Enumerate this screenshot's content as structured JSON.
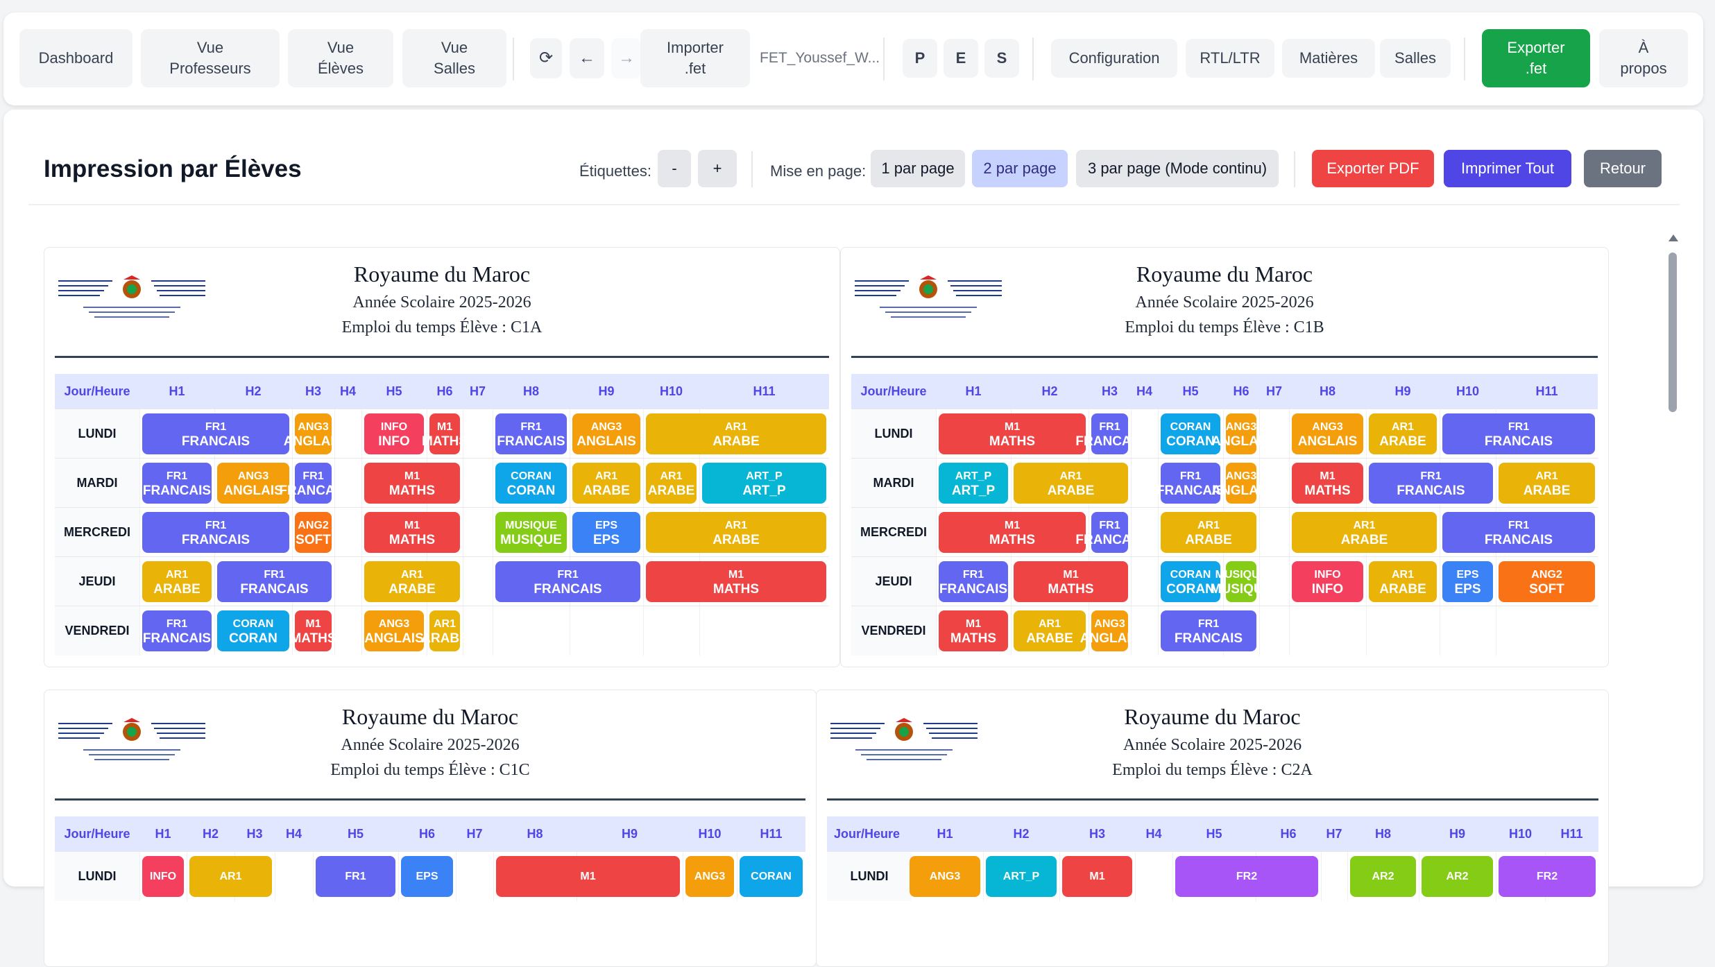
{
  "toolbar": {
    "dashboard": "Dashboard",
    "teachers_l1": "Vue",
    "teachers_l2": "Professeurs",
    "students_l1": "Vue",
    "students_l2": "Élèves",
    "rooms_l1": "Vue",
    "rooms_l2": "Salles",
    "refresh": "⟳",
    "back": "←",
    "forward": "→",
    "import_l1": "Importer",
    "import_l2": ".fet",
    "file_name": "FET_Youssef_W...",
    "p": "P",
    "e": "E",
    "s": "S",
    "configuration": "Configuration",
    "rtl": "RTL/LTR",
    "subjects": "Matières",
    "rooms": "Salles",
    "export_l1": "Exporter",
    "export_l2": ".fet",
    "about_l1": "À",
    "about_l2": "propos"
  },
  "panel": {
    "title": "Impression par Élèves",
    "labels_label": "Étiquettes:",
    "minus": "-",
    "plus": "+",
    "layout_label": "Mise en page:",
    "one_per_page": "1 par page",
    "two_per_page": "2 par page",
    "three_per_page": "3 par page (Mode continu)",
    "export_pdf": "Exporter PDF",
    "print_all": "Imprimer Tout",
    "back": "Retour"
  },
  "colors": {
    "FR": "#6366f1",
    "ANG": "#f59e0b",
    "INFO": "#f43f5e",
    "M": "#ef4444",
    "AR": "#eab308",
    "CORAN": "#0ea5e9",
    "ART": "#06b6d4",
    "MUSIQUE": "#84cc16",
    "EPS": "#3b82f6",
    "SOFT": "#f97316",
    "FR2": "#a855f7",
    "AR2": "#84cc16"
  },
  "common": {
    "kingdom": "Royaume du Maroc",
    "year": "Année Scolaire 2025-2026",
    "col_header": "Jour/Heure",
    "hours": [
      "H1",
      "H2",
      "H3",
      "H4",
      "H5",
      "H6",
      "H7",
      "H8",
      "H9",
      "H10",
      "H11"
    ],
    "days": [
      "LUNDI",
      "MARDI",
      "MERCREDI",
      "JEUDI",
      "VENDREDI"
    ]
  },
  "cards": [
    {
      "title": "Emploi du temps Élève : C1A",
      "rows": [
        [
          [
            "FR1",
            "FRANCAIS",
            "FR",
            1,
            2
          ],
          [
            "ANG3",
            "ANGLAIS",
            "ANG",
            3,
            1
          ],
          [
            "INFO",
            "INFO",
            "INFO",
            5,
            1
          ],
          [
            "M1",
            "MATHS",
            "M",
            6,
            1
          ],
          [
            "FR1",
            "FRANCAIS",
            "FR",
            8,
            1
          ],
          [
            "ANG3",
            "ANGLAIS",
            "ANG",
            9,
            1
          ],
          [
            "AR1",
            "ARABE",
            "AR",
            10,
            2
          ]
        ],
        [
          [
            "FR1",
            "FRANCAIS",
            "FR",
            1,
            1
          ],
          [
            "ANG3",
            "ANGLAIS",
            "ANG",
            2,
            1
          ],
          [
            "FR1",
            "FRANCAIS",
            "FR",
            3,
            1
          ],
          [
            "M1",
            "MATHS",
            "M",
            5,
            2
          ],
          [
            "CORAN",
            "CORAN",
            "CORAN",
            8,
            1
          ],
          [
            "AR1",
            "ARABE",
            "AR",
            9,
            1
          ],
          [
            "AR1",
            "ARABE",
            "AR",
            10,
            1
          ],
          [
            "ART_P",
            "ART_P",
            "ART",
            11,
            1
          ]
        ],
        [
          [
            "FR1",
            "FRANCAIS",
            "FR",
            1,
            2
          ],
          [
            "ANG2",
            "SOFT",
            "SOFT",
            3,
            1
          ],
          [
            "M1",
            "MATHS",
            "M",
            5,
            2
          ],
          [
            "MUSIQUE",
            "MUSIQUE",
            "MUSIQUE",
            8,
            1
          ],
          [
            "EPS",
            "EPS",
            "EPS",
            9,
            1
          ],
          [
            "AR1",
            "ARABE",
            "AR",
            10,
            2
          ]
        ],
        [
          [
            "AR1",
            "ARABE",
            "AR",
            1,
            1
          ],
          [
            "FR1",
            "FRANCAIS",
            "FR",
            2,
            2
          ],
          [
            "AR1",
            "ARABE",
            "AR",
            5,
            2
          ],
          [
            "FR1",
            "FRANCAIS",
            "FR",
            8,
            2
          ],
          [
            "M1",
            "MATHS",
            "M",
            10,
            2
          ]
        ],
        [
          [
            "FR1",
            "FRANCAIS",
            "FR",
            1,
            1
          ],
          [
            "CORAN",
            "CORAN",
            "CORAN",
            2,
            1
          ],
          [
            "M1",
            "MATHS",
            "M",
            3,
            1
          ],
          [
            "ANG3",
            "ANGLAIS",
            "ANG",
            5,
            1
          ],
          [
            "AR1",
            "ARABE",
            "AR",
            6,
            1
          ]
        ]
      ]
    },
    {
      "title": "Emploi du temps Élève : C1B",
      "rows": [
        [
          [
            "M1",
            "MATHS",
            "M",
            1,
            2
          ],
          [
            "FR1",
            "FRANCAIS",
            "FR",
            3,
            1
          ],
          [
            "CORAN",
            "CORAN",
            "CORAN",
            5,
            1
          ],
          [
            "ANG3",
            "ANGLAIS",
            "ANG",
            6,
            1
          ],
          [
            "ANG3",
            "ANGLAIS",
            "ANG",
            8,
            1
          ],
          [
            "AR1",
            "ARABE",
            "AR",
            9,
            1
          ],
          [
            "FR1",
            "FRANCAIS",
            "FR",
            10,
            2
          ]
        ],
        [
          [
            "ART_P",
            "ART_P",
            "ART",
            1,
            1
          ],
          [
            "AR1",
            "ARABE",
            "AR",
            2,
            2
          ],
          [
            "FR1",
            "FRANCAIS",
            "FR",
            5,
            1
          ],
          [
            "ANG3",
            "ANGLAIS",
            "ANG",
            6,
            1
          ],
          [
            "M1",
            "MATHS",
            "M",
            8,
            1
          ],
          [
            "FR1",
            "FRANCAIS",
            "FR",
            9,
            2
          ],
          [
            "AR1",
            "ARABE",
            "AR",
            11,
            1
          ]
        ],
        [
          [
            "M1",
            "MATHS",
            "M",
            1,
            2
          ],
          [
            "FR1",
            "FRANCAIS",
            "FR",
            3,
            1
          ],
          [
            "AR1",
            "ARABE",
            "AR",
            5,
            2
          ],
          [
            "AR1",
            "ARABE",
            "AR",
            8,
            2
          ],
          [
            "FR1",
            "FRANCAIS",
            "FR",
            10,
            2
          ]
        ],
        [
          [
            "FR1",
            "FRANCAIS",
            "FR",
            1,
            1
          ],
          [
            "M1",
            "MATHS",
            "M",
            2,
            2
          ],
          [
            "CORAN",
            "CORAN",
            "CORAN",
            5,
            1
          ],
          [
            "MUSIQUE",
            "MUSIQUE",
            "MUSIQUE",
            6,
            1
          ],
          [
            "INFO",
            "INFO",
            "INFO",
            8,
            1
          ],
          [
            "AR1",
            "ARABE",
            "AR",
            9,
            1
          ],
          [
            "EPS",
            "EPS",
            "EPS",
            10,
            1
          ],
          [
            "ANG2",
            "SOFT",
            "SOFT",
            11,
            1
          ]
        ],
        [
          [
            "M1",
            "MATHS",
            "M",
            1,
            1
          ],
          [
            "AR1",
            "ARABE",
            "AR",
            2,
            1
          ],
          [
            "ANG3",
            "ANGLAIS",
            "ANG",
            3,
            1
          ],
          [
            "FR1",
            "FRANCAIS",
            "FR",
            5,
            2
          ]
        ]
      ]
    },
    {
      "title": "Emploi du temps Élève : C1C",
      "rows": [
        [
          [
            "INFO",
            "",
            "INFO",
            1,
            1
          ],
          [
            "AR1",
            "",
            "AR",
            2,
            2
          ],
          [
            "FR1",
            "",
            "FR",
            5,
            1
          ],
          [
            "EPS",
            "",
            "EPS",
            6,
            1
          ],
          [
            "M1",
            "",
            "M",
            8,
            2
          ],
          [
            "ANG3",
            "",
            "ANG",
            10,
            1
          ],
          [
            "CORAN",
            "",
            "CORAN",
            11,
            1
          ]
        ]
      ]
    },
    {
      "title": "Emploi du temps Élève : C2A",
      "rows": [
        [
          [
            "ANG3",
            "",
            "ANG",
            1,
            1
          ],
          [
            "ART_P",
            "",
            "ART",
            2,
            1
          ],
          [
            "M1",
            "",
            "M",
            3,
            1
          ],
          [
            "FR2",
            "",
            "FR2",
            5,
            2
          ],
          [
            "AR2",
            "",
            "AR2",
            8,
            1
          ],
          [
            "AR2",
            "",
            "AR2",
            9,
            1
          ],
          [
            "FR2",
            "",
            "FR2",
            10,
            2
          ]
        ]
      ]
    }
  ]
}
